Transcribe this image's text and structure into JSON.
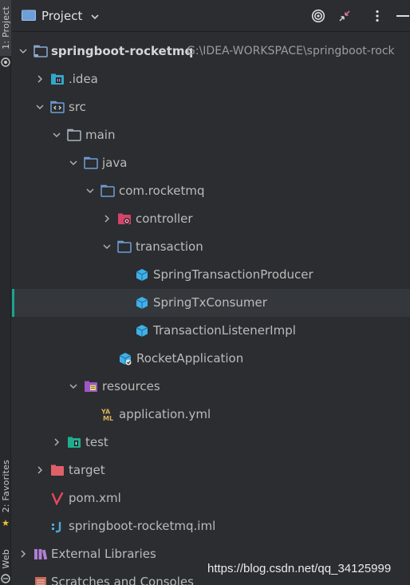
{
  "stripe": {
    "project_tab": "1: Project",
    "favorites_tab": "2: Favorites",
    "web_tab": "Web"
  },
  "header": {
    "title": "Project",
    "icons": [
      "folder-icon",
      "chevron-down-icon",
      "target-icon",
      "collapse-icon",
      "more-icon",
      "minimize-icon"
    ]
  },
  "tree": {
    "root": {
      "label": "springboot-rocketmq",
      "path": "G:\\IDEA-WORKSPACE\\springboot-rock"
    },
    "idea": {
      "label": ".idea"
    },
    "src": {
      "label": "src"
    },
    "main": {
      "label": "main"
    },
    "java": {
      "label": "java"
    },
    "package": {
      "label": "com.rocketmq"
    },
    "controller": {
      "label": "controller"
    },
    "transaction": {
      "label": "transaction"
    },
    "producer": {
      "label": "SpringTransactionProducer"
    },
    "consumer": {
      "label": "SpringTxConsumer"
    },
    "listener": {
      "label": "TransactionListenerImpl"
    },
    "app": {
      "label": "RocketApplication"
    },
    "resources": {
      "label": "resources"
    },
    "yml": {
      "label": "application.yml"
    },
    "test": {
      "label": "test"
    },
    "target": {
      "label": "target"
    },
    "pom": {
      "label": "pom.xml"
    },
    "iml": {
      "label": "springboot-rocketmq.iml"
    },
    "libraries": {
      "label": "External Libraries"
    },
    "scratches": {
      "label": "Scratches and Consoles"
    }
  },
  "watermark": "https://blog.csdn.net/qq_34125999",
  "colors": {
    "background": "#2b2d30",
    "selection": "#34383c",
    "selection_accent": "#1aa392",
    "folder": "#6e9fd8",
    "class": "#3fb0e8",
    "target_folder": "#e0606a",
    "resources_folder": "#9f56c6",
    "test_folder": "#1fae8d"
  }
}
